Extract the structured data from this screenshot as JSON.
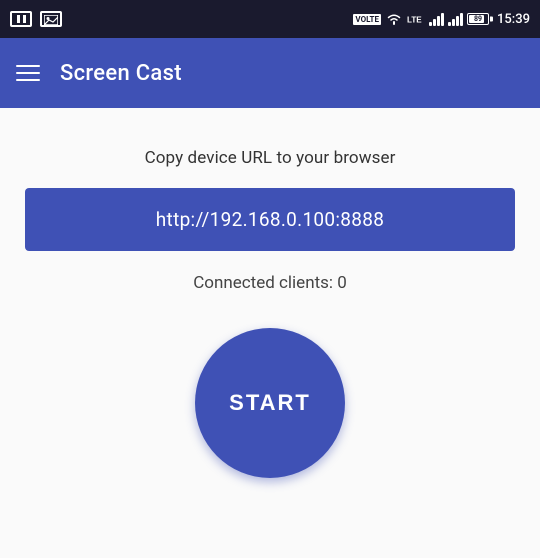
{
  "status_bar": {
    "time": "15:39",
    "battery_level": "89"
  },
  "app_bar": {
    "title": "Screen Cast"
  },
  "main": {
    "instruction": "Copy device URL to your browser",
    "url": "http://192.168.0.100:8888",
    "connected_clients_label": "Connected clients: 0",
    "start_button_label": "START"
  }
}
